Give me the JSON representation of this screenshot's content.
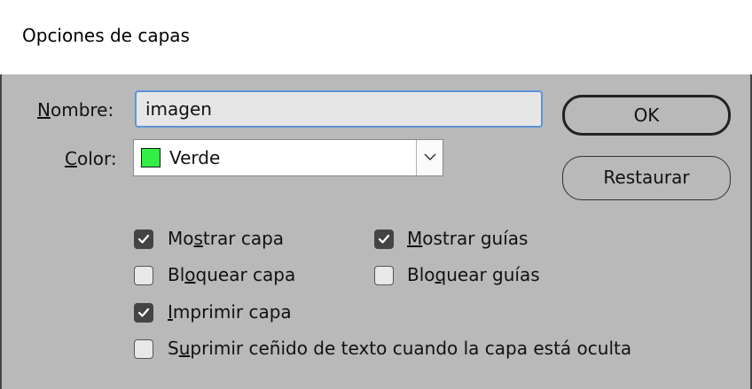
{
  "window": {
    "title": "Opciones de capas"
  },
  "form": {
    "name_label_mnemonic": "N",
    "name_label_rest": "ombre:",
    "name_value": "imagen",
    "color_label_mnemonic": "C",
    "color_label_rest": "olor:",
    "color_value": "Verde",
    "color_swatch_hex": "#33ee44"
  },
  "buttons": {
    "ok_label": "OK",
    "reset_label": "Restaurar"
  },
  "options": {
    "show_layer": {
      "pre": "Mo",
      "mn": "s",
      "post": "trar capa",
      "checked": true
    },
    "lock_layer": {
      "pre": "Bl",
      "mn": "o",
      "post": "quear capa",
      "checked": false
    },
    "print_layer": {
      "pre": "",
      "mn": "I",
      "post": "mprimir capa",
      "checked": true
    },
    "suppress_wrap": {
      "pre": "S",
      "mn": "u",
      "post": "primir ceñido de texto cuando la capa está oculta",
      "checked": false
    },
    "show_guides": {
      "pre": "",
      "mn": "M",
      "post": "ostrar guías",
      "checked": true
    },
    "lock_guides": {
      "pre": "Blo",
      "mn": "q",
      "post": "uear guías",
      "checked": false
    }
  }
}
